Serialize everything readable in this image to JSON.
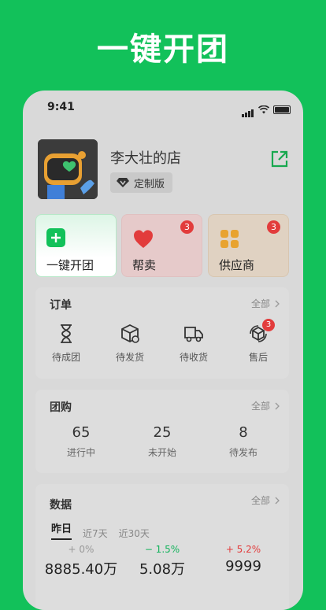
{
  "banner": {
    "title": "一键开团"
  },
  "status_bar": {
    "time": "9:41"
  },
  "shop": {
    "name": "李大壮的店",
    "badge": "定制版"
  },
  "quick_actions": [
    {
      "label": "一键开团",
      "badge": ""
    },
    {
      "label": "帮卖",
      "badge": "3"
    },
    {
      "label": "供应商",
      "badge": "3"
    }
  ],
  "orders": {
    "title": "订单",
    "all_label": "全部",
    "items": [
      {
        "label": "待成团",
        "icon": "hourglass-icon",
        "badge": ""
      },
      {
        "label": "待发货",
        "icon": "package-icon",
        "badge": ""
      },
      {
        "label": "待收货",
        "icon": "truck-icon",
        "badge": ""
      },
      {
        "label": "售后",
        "icon": "after-sales-icon",
        "badge": "3"
      }
    ]
  },
  "group_buy": {
    "title": "团购",
    "all_label": "全部",
    "stats": [
      {
        "value": "65",
        "label": "进行中"
      },
      {
        "value": "25",
        "label": "未开始"
      },
      {
        "value": "8",
        "label": "待发布"
      }
    ]
  },
  "data_section": {
    "title": "数据",
    "all_label": "全部",
    "tabs": [
      "昨日",
      "近7天",
      "近30天"
    ],
    "active_tab": "昨日",
    "metrics": [
      {
        "delta": "+ 0%",
        "value": "8885.40万",
        "delta_color": "#999999"
      },
      {
        "delta": "− 1.5%",
        "value": "5.08万",
        "delta_color": "#14B35C"
      },
      {
        "delta": "+ 5.2%",
        "value": "9999",
        "delta_color": "#E23C3C"
      }
    ]
  },
  "colors": {
    "brand_green": "#12C15A",
    "badge_red": "#E23C3C",
    "heart_red": "#E23C3C",
    "grid_orange": "#E8A330"
  }
}
